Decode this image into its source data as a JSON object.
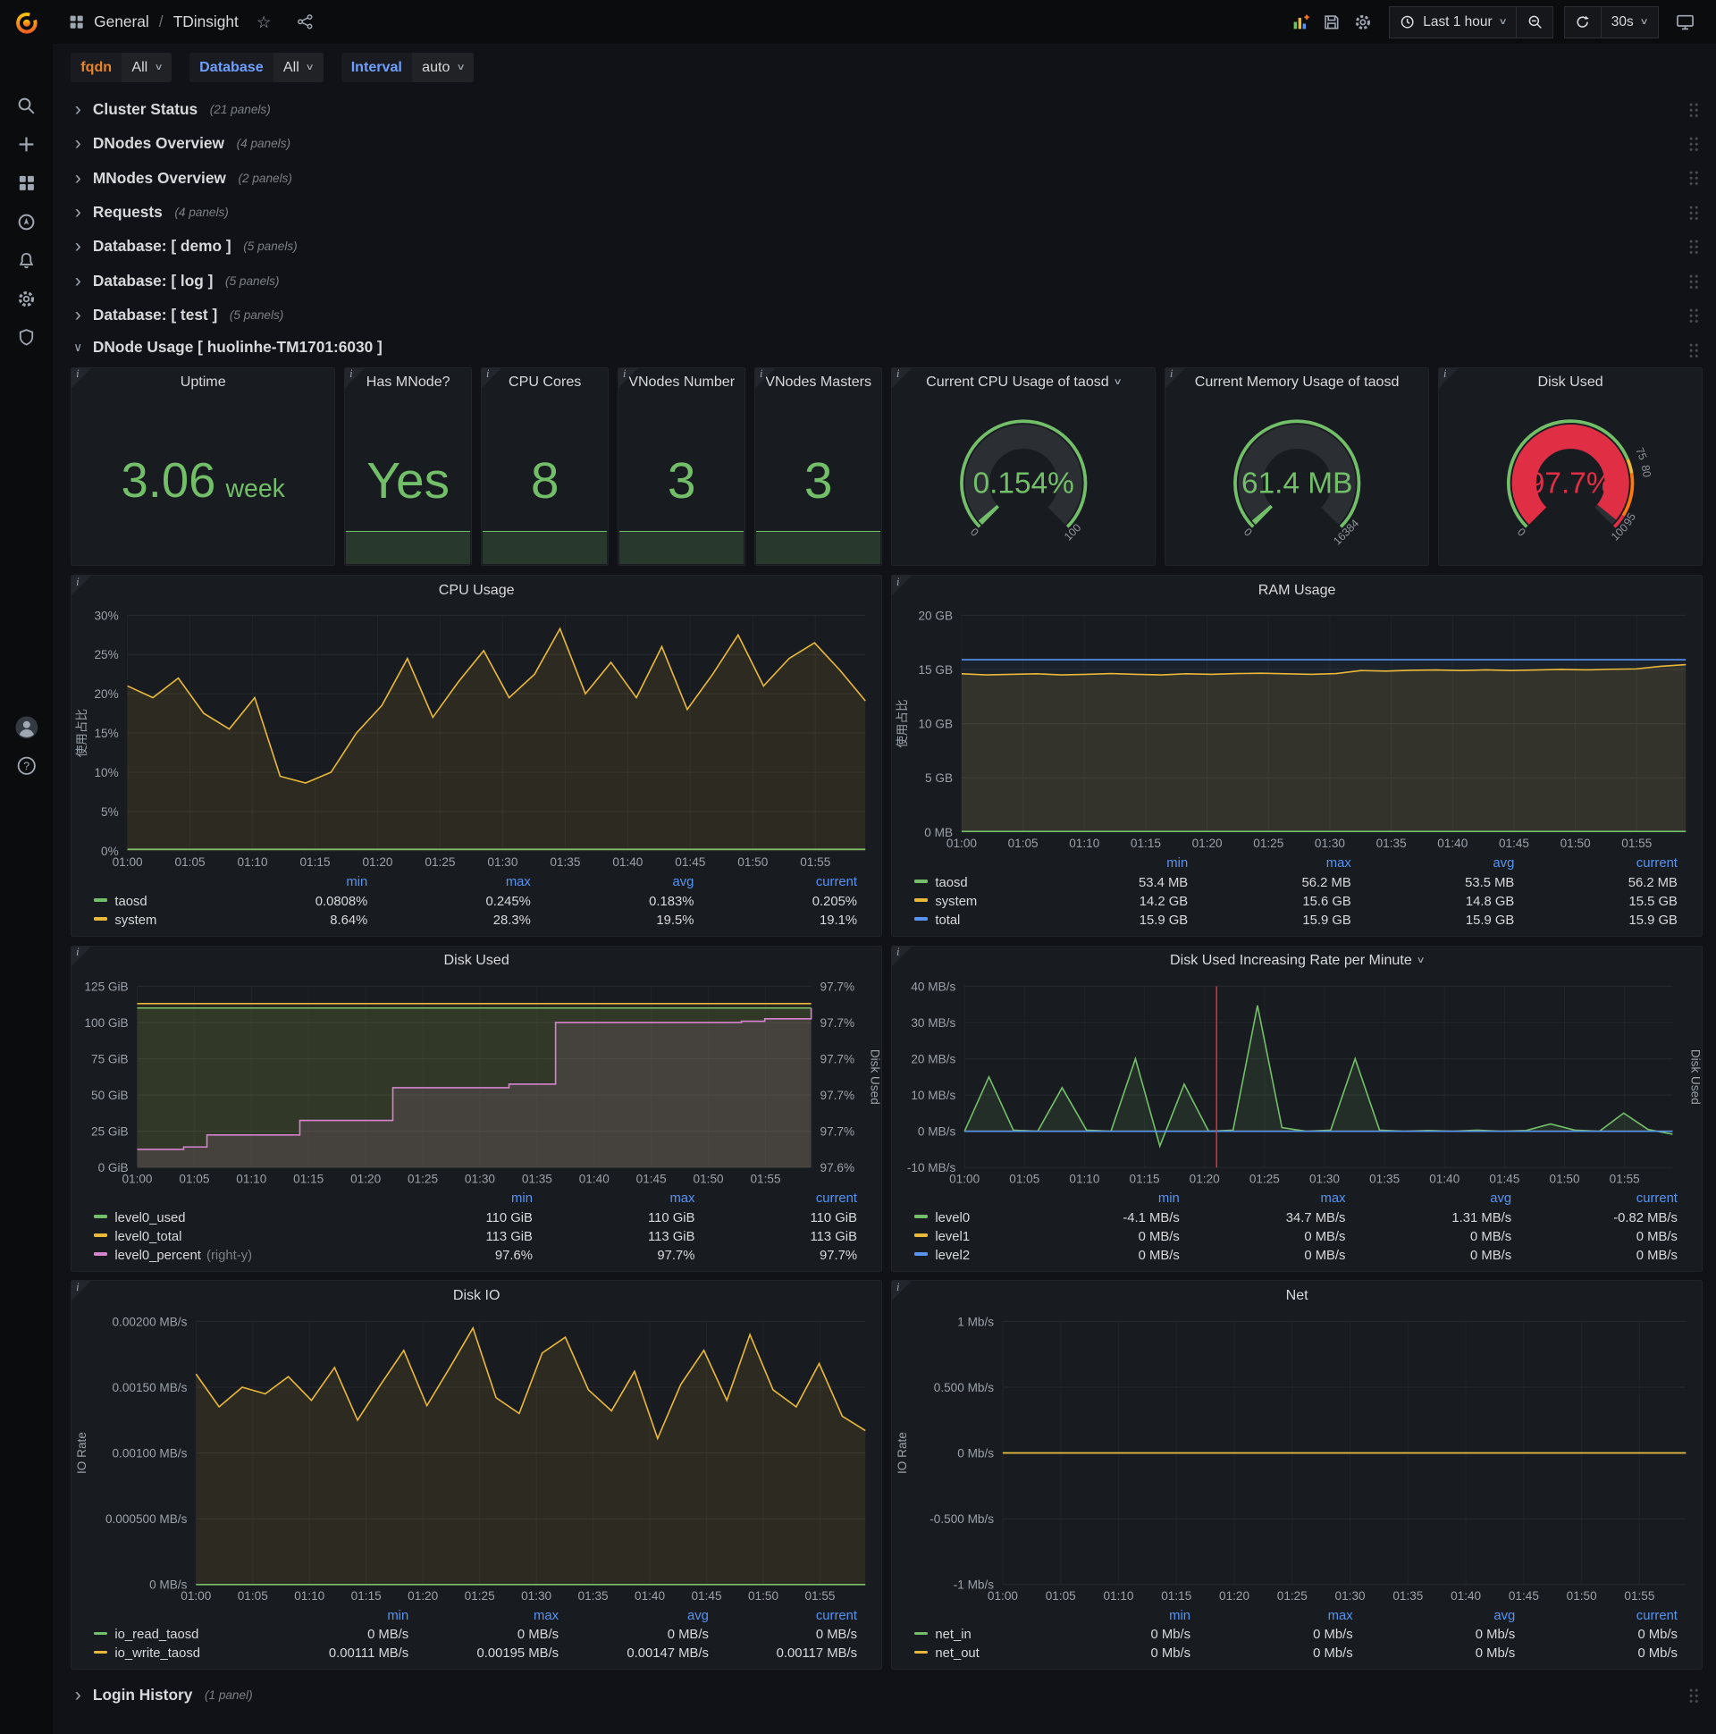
{
  "icons": {
    "chevron_right": "›",
    "chevron_down": "∨",
    "caret_down": "∨",
    "star": "☆"
  },
  "colors": {
    "green": "#73bf69",
    "yellow": "#eab839",
    "blue": "#5794f2",
    "pink": "#d683ce",
    "red": "#e02f44",
    "orange": "#ff780a"
  },
  "nav": {
    "section": "General",
    "separator": "/",
    "title": "TDinsight",
    "time_range": "Last 1 hour",
    "refresh_interval": "30s"
  },
  "sidebar": {
    "items": [
      "search",
      "create",
      "dashboards",
      "explore",
      "alerting",
      "configuration",
      "server-admin"
    ],
    "bottom": [
      "user-avatar",
      "help"
    ]
  },
  "variables": [
    {
      "label": "fqdn",
      "value": "All",
      "label_color": "#e5842b"
    },
    {
      "label": "Database",
      "value": "All",
      "label_color": "#6e9fff"
    },
    {
      "label": "Interval",
      "value": "auto",
      "label_color": "#6e9fff"
    }
  ],
  "rows_collapsed": [
    {
      "title": "Cluster Status",
      "panels": "(21 panels)"
    },
    {
      "title": "DNodes Overview",
      "panels": "(4 panels)"
    },
    {
      "title": "MNodes Overview",
      "panels": "(2 panels)"
    },
    {
      "title": "Requests",
      "panels": "(4 panels)"
    },
    {
      "title": "Database: [ demo ]",
      "panels": "(5 panels)"
    },
    {
      "title": "Database: [ log ]",
      "panels": "(5 panels)"
    },
    {
      "title": "Database: [ test ]",
      "panels": "(5 panels)"
    }
  ],
  "row_expanded": {
    "title": "DNode Usage [ huolinhe-TM1701:6030 ]"
  },
  "row_footer": {
    "title": "Login History",
    "panels": "(1 panel)"
  },
  "stat_panels": [
    {
      "title": "Uptime",
      "value": "3.06",
      "unit": "week"
    },
    {
      "title": "Has MNode?",
      "value": "Yes"
    },
    {
      "title": "CPU Cores",
      "value": "8"
    },
    {
      "title": "VNodes Number",
      "value": "3"
    },
    {
      "title": "VNodes Masters",
      "value": "3"
    }
  ],
  "gauges": [
    {
      "title": "Current CPU Usage of taosd",
      "has_caret": true,
      "value_display": "0.154%",
      "frac": 0.0015,
      "color": "#73bf69",
      "value_color": "#73bf69",
      "labels": [
        {
          "text": "0",
          "frac": 0
        },
        {
          "text": "100",
          "frac": 1
        }
      ],
      "thresholds": [
        {
          "color": "#73bf69",
          "from": 0,
          "to": 1
        }
      ]
    },
    {
      "title": "Current Memory Usage of taosd",
      "value_display": "61.4 MB",
      "frac": 0.0037,
      "color": "#73bf69",
      "value_color": "#73bf69",
      "labels": [
        {
          "text": "0",
          "frac": 0
        },
        {
          "text": "16384",
          "frac": 1
        }
      ],
      "thresholds": [
        {
          "color": "#73bf69",
          "from": 0,
          "to": 1
        }
      ]
    },
    {
      "title": "Disk Used",
      "value_display": "97.7%",
      "frac": 0.977,
      "color": "#e02f44",
      "value_color": "#e02f44",
      "labels": [
        {
          "text": "0",
          "frac": 0
        },
        {
          "text": "75",
          "frac": 0.75
        },
        {
          "text": "80",
          "frac": 0.8
        },
        {
          "text": "95",
          "frac": 0.95
        },
        {
          "text": "100",
          "frac": 1
        }
      ],
      "thresholds": [
        {
          "color": "#73bf69",
          "from": 0,
          "to": 0.75
        },
        {
          "color": "#eab839",
          "from": 0.75,
          "to": 0.8
        },
        {
          "color": "#ff780a",
          "from": 0.8,
          "to": 0.95
        },
        {
          "color": "#e02f44",
          "from": 0.95,
          "to": 1
        }
      ]
    }
  ],
  "chart_data": [
    {
      "id": "cpu-usage",
      "type": "line",
      "title": "CPU Usage",
      "ylabel": "使用占比",
      "x_ticks": [
        "01:00",
        "01:05",
        "01:10",
        "01:15",
        "01:20",
        "01:25",
        "01:30",
        "01:35",
        "01:40",
        "01:45",
        "01:50",
        "01:55"
      ],
      "y_ticks": [
        "0%",
        "5%",
        "10%",
        "15%",
        "20%",
        "25%",
        "30%"
      ],
      "ylim": [
        0,
        30
      ],
      "series": [
        {
          "name": "taosd",
          "color": "#73bf69",
          "fill_opacity": 0.1,
          "values": [
            0.2,
            0.2
          ]
        },
        {
          "name": "system",
          "color": "#eab839",
          "fill_opacity": 0.1,
          "values": [
            21,
            19.5,
            22,
            17.5,
            15.5,
            19.5,
            9.5,
            8.64,
            10,
            15,
            18.5,
            24.5,
            17,
            21.5,
            25.5,
            19.5,
            22.5,
            28.3,
            20,
            24,
            19.5,
            26,
            18,
            22.5,
            27.5,
            21,
            24.5,
            26.5,
            23,
            19.1
          ]
        }
      ],
      "legend": {
        "headers": [
          "min",
          "max",
          "avg",
          "current"
        ],
        "rows": [
          {
            "name": "taosd",
            "color": "#73bf69",
            "values": [
              "0.0808%",
              "0.245%",
              "0.183%",
              "0.205%"
            ]
          },
          {
            "name": "system",
            "color": "#eab839",
            "values": [
              "8.64%",
              "28.3%",
              "19.5%",
              "19.1%"
            ]
          }
        ]
      }
    },
    {
      "id": "ram-usage",
      "type": "line",
      "title": "RAM Usage",
      "ylabel": "使用占比",
      "x_ticks": [
        "01:00",
        "01:05",
        "01:10",
        "01:15",
        "01:20",
        "01:25",
        "01:30",
        "01:35",
        "01:40",
        "01:45",
        "01:50",
        "01:55"
      ],
      "y_ticks": [
        "0 MB",
        "5 GB",
        "10 GB",
        "15 GB",
        "20 GB"
      ],
      "ylim": [
        0,
        20
      ],
      "series": [
        {
          "name": "total",
          "color": "#5794f2",
          "fill_opacity": 0.06,
          "values": [
            15.9,
            15.9
          ]
        },
        {
          "name": "system",
          "color": "#eab839",
          "fill_opacity": 0.12,
          "values": [
            14.6,
            14.5,
            14.55,
            14.6,
            14.5,
            14.55,
            14.62,
            14.55,
            14.5,
            14.6,
            14.55,
            14.62,
            14.65,
            14.6,
            14.55,
            14.62,
            14.9,
            14.85,
            14.92,
            14.95,
            14.9,
            14.96,
            14.9,
            14.95,
            15.0,
            14.96,
            15.02,
            15.05,
            15.3,
            15.45
          ]
        },
        {
          "name": "taosd",
          "color": "#73bf69",
          "fill_opacity": 0.1,
          "values": [
            0.055,
            0.055
          ]
        }
      ],
      "legend": {
        "headers": [
          "min",
          "max",
          "avg",
          "current"
        ],
        "rows": [
          {
            "name": "taosd",
            "color": "#73bf69",
            "values": [
              "53.4 MB",
              "56.2 MB",
              "53.5 MB",
              "56.2 MB"
            ]
          },
          {
            "name": "system",
            "color": "#eab839",
            "values": [
              "14.2 GB",
              "15.6 GB",
              "14.8 GB",
              "15.5 GB"
            ]
          },
          {
            "name": "total",
            "color": "#5794f2",
            "values": [
              "15.9 GB",
              "15.9 GB",
              "15.9 GB",
              "15.9 GB"
            ]
          }
        ]
      }
    },
    {
      "id": "disk-used",
      "type": "line",
      "title": "Disk Used",
      "x_ticks": [
        "01:00",
        "01:05",
        "01:10",
        "01:15",
        "01:20",
        "01:25",
        "01:30",
        "01:35",
        "01:40",
        "01:45",
        "01:50",
        "01:55"
      ],
      "y_ticks": [
        "0 GiB",
        "25 GiB",
        "50 GiB",
        "75 GiB",
        "100 GiB",
        "125 GiB"
      ],
      "ylim": [
        0,
        125
      ],
      "y2_ticks": [
        "97.6%",
        "97.7%",
        "97.7%",
        "97.7%",
        "97.7%",
        "97.7%"
      ],
      "y2lim": [
        97.595,
        97.745
      ],
      "y2label": "Disk Used",
      "series": [
        {
          "name": "level0_used",
          "color": "#73bf69",
          "fill_opacity": 0.12,
          "values": [
            110,
            110
          ]
        },
        {
          "name": "level0_total",
          "color": "#eab839",
          "fill_opacity": 0.08,
          "values": [
            113,
            113
          ]
        },
        {
          "name": "level0_percent",
          "color": "#d683ce",
          "fill_opacity": 0.12,
          "yaxis": 2,
          "step": true,
          "values": [
            97.61,
            97.61,
            97.612,
            97.622,
            97.622,
            97.622,
            97.622,
            97.634,
            97.634,
            97.634,
            97.634,
            97.661,
            97.661,
            97.661,
            97.661,
            97.661,
            97.664,
            97.664,
            97.715,
            97.715,
            97.715,
            97.715,
            97.715,
            97.715,
            97.715,
            97.715,
            97.716,
            97.718,
            97.718,
            97.727
          ]
        }
      ],
      "legend": {
        "headers": [
          "min",
          "max",
          "current"
        ],
        "rows": [
          {
            "name": "level0_used",
            "color": "#73bf69",
            "values": [
              "110 GiB",
              "110 GiB",
              "110 GiB"
            ]
          },
          {
            "name": "level0_total",
            "color": "#eab839",
            "values": [
              "113 GiB",
              "113 GiB",
              "113 GiB"
            ]
          },
          {
            "name": "level0_percent",
            "color": "#d683ce",
            "suffix": "(right-y)",
            "values": [
              "97.6%",
              "97.7%",
              "97.7%"
            ]
          }
        ]
      }
    },
    {
      "id": "disk-rate",
      "type": "line",
      "title": "Disk Used Increasing Rate per Minute",
      "has_caret": true,
      "x_ticks": [
        "01:00",
        "01:05",
        "01:10",
        "01:15",
        "01:20",
        "01:25",
        "01:30",
        "01:35",
        "01:40",
        "01:45",
        "01:50",
        "01:55"
      ],
      "y_ticks": [
        "-10 MB/s",
        "0 MB/s",
        "10 MB/s",
        "20 MB/s",
        "30 MB/s",
        "40 MB/s"
      ],
      "ylim": [
        -10,
        40
      ],
      "y2label": "Disk Used",
      "annotation": {
        "x_frac": 0.356,
        "color": "#e02f44"
      },
      "series": [
        {
          "name": "level0",
          "color": "#73bf69",
          "fill_opacity": 0.12,
          "values": [
            0,
            15,
            0.3,
            0,
            12,
            0.3,
            0,
            20,
            -4.1,
            13,
            0,
            0.3,
            34.7,
            1,
            0,
            0.3,
            20,
            0.3,
            0,
            0.2,
            0,
            0.3,
            0,
            0.2,
            2,
            0.3,
            0,
            5,
            0.5,
            -0.82
          ]
        },
        {
          "name": "level1",
          "color": "#eab839",
          "values": [
            0,
            0
          ]
        },
        {
          "name": "level2",
          "color": "#5794f2",
          "values": [
            0,
            0
          ]
        }
      ],
      "legend": {
        "headers": [
          "min",
          "max",
          "avg",
          "current"
        ],
        "rows": [
          {
            "name": "level0",
            "color": "#73bf69",
            "values": [
              "-4.1 MB/s",
              "34.7 MB/s",
              "1.31 MB/s",
              "-0.82 MB/s"
            ]
          },
          {
            "name": "level1",
            "color": "#eab839",
            "values": [
              "0 MB/s",
              "0 MB/s",
              "0 MB/s",
              "0 MB/s"
            ]
          },
          {
            "name": "level2",
            "color": "#5794f2",
            "values": [
              "0 MB/s",
              "0 MB/s",
              "0 MB/s",
              "0 MB/s"
            ]
          }
        ]
      }
    },
    {
      "id": "disk-io",
      "type": "line",
      "title": "Disk IO",
      "ylabel": "IO Rate",
      "x_ticks": [
        "01:00",
        "01:05",
        "01:10",
        "01:15",
        "01:20",
        "01:25",
        "01:30",
        "01:35",
        "01:40",
        "01:45",
        "01:50",
        "01:55"
      ],
      "y_ticks": [
        "0 MB/s",
        "0.000500 MB/s",
        "0.00100 MB/s",
        "0.00150 MB/s",
        "0.00200 MB/s"
      ],
      "ylim": [
        0,
        0.002
      ],
      "series": [
        {
          "name": "io_read_taosd",
          "color": "#73bf69",
          "fill_opacity": 0.1,
          "values": [
            0,
            0
          ]
        },
        {
          "name": "io_write_taosd",
          "color": "#eab839",
          "fill_opacity": 0.1,
          "values": [
            0.0016,
            0.00135,
            0.0015,
            0.00145,
            0.00158,
            0.0014,
            0.00165,
            0.00125,
            0.00152,
            0.00178,
            0.00136,
            0.00165,
            0.00195,
            0.00142,
            0.0013,
            0.00176,
            0.00188,
            0.00148,
            0.00132,
            0.00162,
            0.00111,
            0.00152,
            0.00178,
            0.0014,
            0.0019,
            0.00148,
            0.00135,
            0.00168,
            0.00128,
            0.00117
          ]
        }
      ],
      "legend": {
        "headers": [
          "min",
          "max",
          "avg",
          "current"
        ],
        "rows": [
          {
            "name": "io_read_taosd",
            "color": "#73bf69",
            "values": [
              "0 MB/s",
              "0 MB/s",
              "0 MB/s",
              "0 MB/s"
            ]
          },
          {
            "name": "io_write_taosd",
            "color": "#eab839",
            "values": [
              "0.00111 MB/s",
              "0.00195 MB/s",
              "0.00147 MB/s",
              "0.00117 MB/s"
            ]
          }
        ]
      }
    },
    {
      "id": "net",
      "type": "line",
      "title": "Net",
      "ylabel": "IO Rate",
      "x_ticks": [
        "01:00",
        "01:05",
        "01:10",
        "01:15",
        "01:20",
        "01:25",
        "01:30",
        "01:35",
        "01:40",
        "01:45",
        "01:50",
        "01:55"
      ],
      "y_ticks": [
        "-1 Mb/s",
        "-0.500 Mb/s",
        "0 Mb/s",
        "0.500 Mb/s",
        "1 Mb/s"
      ],
      "ylim": [
        -1,
        1
      ],
      "series": [
        {
          "name": "net_in",
          "color": "#73bf69",
          "values": [
            0,
            0
          ]
        },
        {
          "name": "net_out",
          "color": "#eab839",
          "values": [
            0,
            0
          ]
        }
      ],
      "legend": {
        "headers": [
          "min",
          "max",
          "avg",
          "current"
        ],
        "rows": [
          {
            "name": "net_in",
            "color": "#73bf69",
            "values": [
              "0 Mb/s",
              "0 Mb/s",
              "0 Mb/s",
              "0 Mb/s"
            ]
          },
          {
            "name": "net_out",
            "color": "#eab839",
            "values": [
              "0 Mb/s",
              "0 Mb/s",
              "0 Mb/s",
              "0 Mb/s"
            ]
          }
        ]
      }
    }
  ]
}
